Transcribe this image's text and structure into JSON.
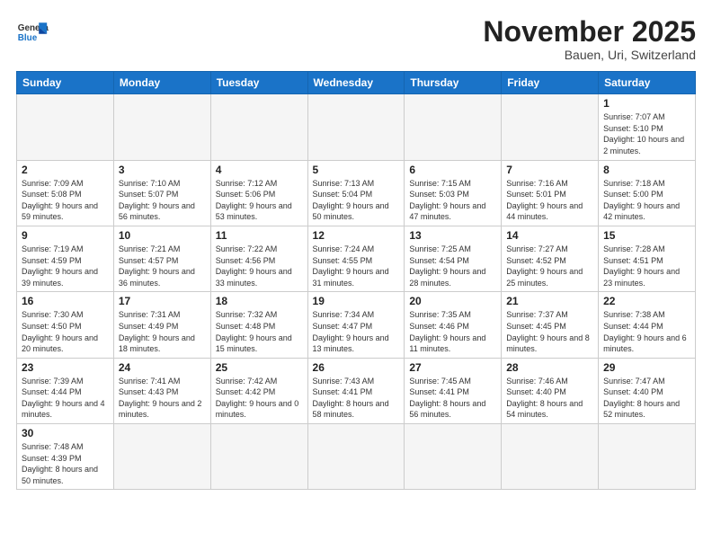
{
  "header": {
    "logo_general": "General",
    "logo_blue": "Blue",
    "month_year": "November 2025",
    "location": "Bauen, Uri, Switzerland"
  },
  "days_of_week": [
    "Sunday",
    "Monday",
    "Tuesday",
    "Wednesday",
    "Thursday",
    "Friday",
    "Saturday"
  ],
  "weeks": [
    [
      {
        "day": "",
        "info": ""
      },
      {
        "day": "",
        "info": ""
      },
      {
        "day": "",
        "info": ""
      },
      {
        "day": "",
        "info": ""
      },
      {
        "day": "",
        "info": ""
      },
      {
        "day": "",
        "info": ""
      },
      {
        "day": "1",
        "info": "Sunrise: 7:07 AM\nSunset: 5:10 PM\nDaylight: 10 hours\nand 2 minutes."
      }
    ],
    [
      {
        "day": "2",
        "info": "Sunrise: 7:09 AM\nSunset: 5:08 PM\nDaylight: 9 hours\nand 59 minutes."
      },
      {
        "day": "3",
        "info": "Sunrise: 7:10 AM\nSunset: 5:07 PM\nDaylight: 9 hours\nand 56 minutes."
      },
      {
        "day": "4",
        "info": "Sunrise: 7:12 AM\nSunset: 5:06 PM\nDaylight: 9 hours\nand 53 minutes."
      },
      {
        "day": "5",
        "info": "Sunrise: 7:13 AM\nSunset: 5:04 PM\nDaylight: 9 hours\nand 50 minutes."
      },
      {
        "day": "6",
        "info": "Sunrise: 7:15 AM\nSunset: 5:03 PM\nDaylight: 9 hours\nand 47 minutes."
      },
      {
        "day": "7",
        "info": "Sunrise: 7:16 AM\nSunset: 5:01 PM\nDaylight: 9 hours\nand 44 minutes."
      },
      {
        "day": "8",
        "info": "Sunrise: 7:18 AM\nSunset: 5:00 PM\nDaylight: 9 hours\nand 42 minutes."
      }
    ],
    [
      {
        "day": "9",
        "info": "Sunrise: 7:19 AM\nSunset: 4:59 PM\nDaylight: 9 hours\nand 39 minutes."
      },
      {
        "day": "10",
        "info": "Sunrise: 7:21 AM\nSunset: 4:57 PM\nDaylight: 9 hours\nand 36 minutes."
      },
      {
        "day": "11",
        "info": "Sunrise: 7:22 AM\nSunset: 4:56 PM\nDaylight: 9 hours\nand 33 minutes."
      },
      {
        "day": "12",
        "info": "Sunrise: 7:24 AM\nSunset: 4:55 PM\nDaylight: 9 hours\nand 31 minutes."
      },
      {
        "day": "13",
        "info": "Sunrise: 7:25 AM\nSunset: 4:54 PM\nDaylight: 9 hours\nand 28 minutes."
      },
      {
        "day": "14",
        "info": "Sunrise: 7:27 AM\nSunset: 4:52 PM\nDaylight: 9 hours\nand 25 minutes."
      },
      {
        "day": "15",
        "info": "Sunrise: 7:28 AM\nSunset: 4:51 PM\nDaylight: 9 hours\nand 23 minutes."
      }
    ],
    [
      {
        "day": "16",
        "info": "Sunrise: 7:30 AM\nSunset: 4:50 PM\nDaylight: 9 hours\nand 20 minutes."
      },
      {
        "day": "17",
        "info": "Sunrise: 7:31 AM\nSunset: 4:49 PM\nDaylight: 9 hours\nand 18 minutes."
      },
      {
        "day": "18",
        "info": "Sunrise: 7:32 AM\nSunset: 4:48 PM\nDaylight: 9 hours\nand 15 minutes."
      },
      {
        "day": "19",
        "info": "Sunrise: 7:34 AM\nSunset: 4:47 PM\nDaylight: 9 hours\nand 13 minutes."
      },
      {
        "day": "20",
        "info": "Sunrise: 7:35 AM\nSunset: 4:46 PM\nDaylight: 9 hours\nand 11 minutes."
      },
      {
        "day": "21",
        "info": "Sunrise: 7:37 AM\nSunset: 4:45 PM\nDaylight: 9 hours\nand 8 minutes."
      },
      {
        "day": "22",
        "info": "Sunrise: 7:38 AM\nSunset: 4:44 PM\nDaylight: 9 hours\nand 6 minutes."
      }
    ],
    [
      {
        "day": "23",
        "info": "Sunrise: 7:39 AM\nSunset: 4:44 PM\nDaylight: 9 hours\nand 4 minutes."
      },
      {
        "day": "24",
        "info": "Sunrise: 7:41 AM\nSunset: 4:43 PM\nDaylight: 9 hours\nand 2 minutes."
      },
      {
        "day": "25",
        "info": "Sunrise: 7:42 AM\nSunset: 4:42 PM\nDaylight: 9 hours\nand 0 minutes."
      },
      {
        "day": "26",
        "info": "Sunrise: 7:43 AM\nSunset: 4:41 PM\nDaylight: 8 hours\nand 58 minutes."
      },
      {
        "day": "27",
        "info": "Sunrise: 7:45 AM\nSunset: 4:41 PM\nDaylight: 8 hours\nand 56 minutes."
      },
      {
        "day": "28",
        "info": "Sunrise: 7:46 AM\nSunset: 4:40 PM\nDaylight: 8 hours\nand 54 minutes."
      },
      {
        "day": "29",
        "info": "Sunrise: 7:47 AM\nSunset: 4:40 PM\nDaylight: 8 hours\nand 52 minutes."
      }
    ],
    [
      {
        "day": "30",
        "info": "Sunrise: 7:48 AM\nSunset: 4:39 PM\nDaylight: 8 hours\nand 50 minutes."
      },
      {
        "day": "",
        "info": ""
      },
      {
        "day": "",
        "info": ""
      },
      {
        "day": "",
        "info": ""
      },
      {
        "day": "",
        "info": ""
      },
      {
        "day": "",
        "info": ""
      },
      {
        "day": "",
        "info": ""
      }
    ]
  ]
}
